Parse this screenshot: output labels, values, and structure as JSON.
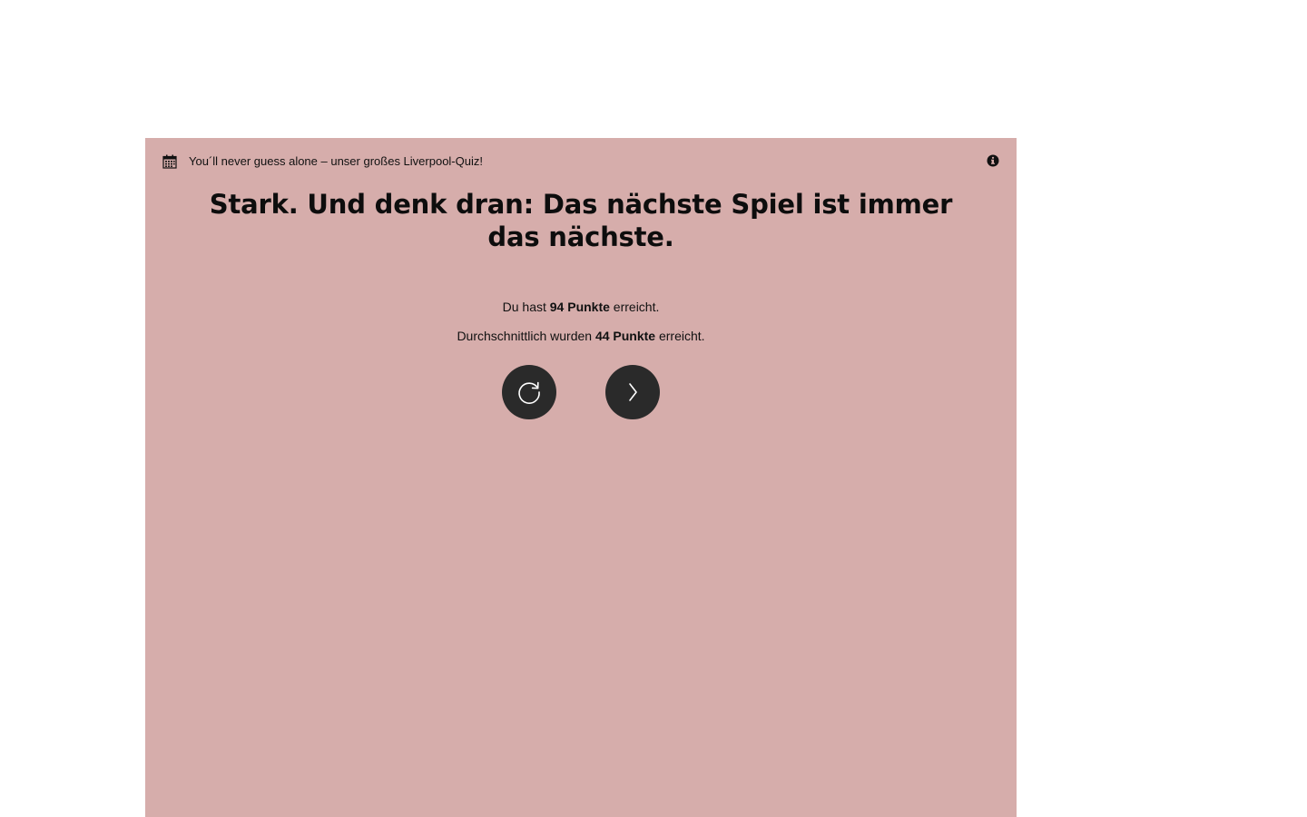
{
  "quiz": {
    "title": "You´ll never guess alone – unser großes Liverpool-Quiz!",
    "headline": "Stark. Und denk dran: Das nächste Spiel ist immer das nächste.",
    "result": {
      "user_prefix": "Du hast ",
      "user_points": "94 Punkte",
      "user_suffix": " erreicht.",
      "avg_prefix": "Durchschnittlich wurden ",
      "avg_points": "44 Punkte",
      "avg_suffix": " erreicht."
    },
    "icons": {
      "header_left": "calendar-icon",
      "header_right": "info-icon",
      "restart": "refresh-icon",
      "next": "chevron-right-icon"
    },
    "colors": {
      "panel_background": "#d6adab",
      "button_background": "#2a2a2a",
      "button_icon": "#ffffff"
    }
  }
}
